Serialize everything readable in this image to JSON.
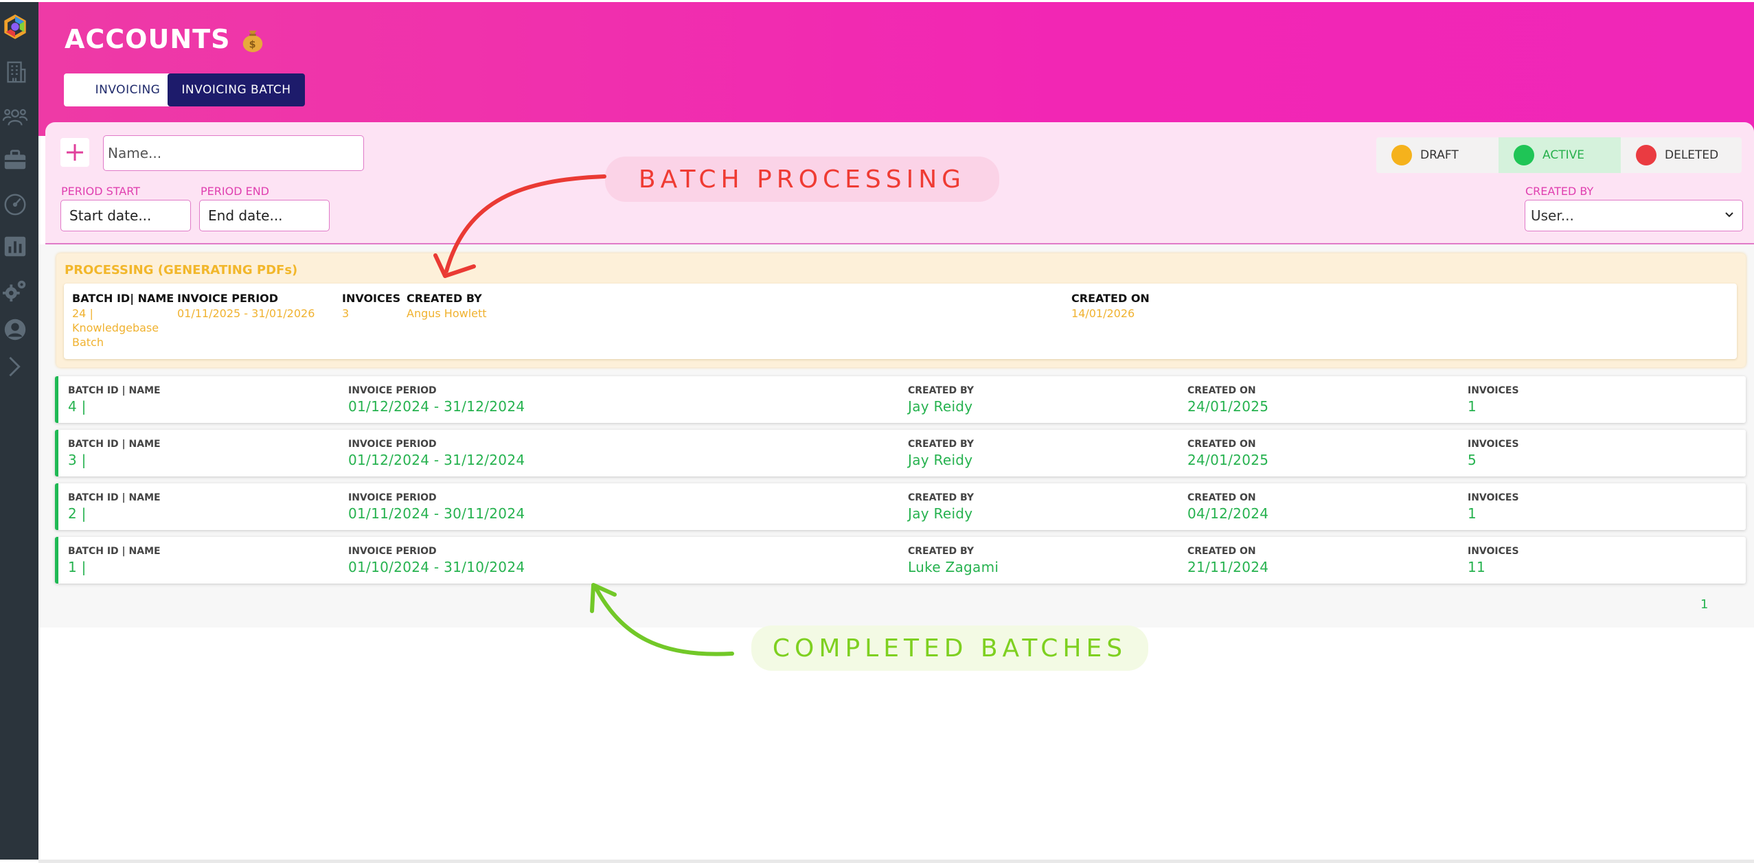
{
  "header": {
    "title": "ACCOUNTS",
    "tabs": [
      {
        "label": "INVOICING",
        "active": false
      },
      {
        "label": "INVOICING BATCH",
        "active": true
      }
    ]
  },
  "sidebar": {
    "items": [
      "logo-icon",
      "building-icon",
      "team-icon",
      "briefcase-icon",
      "speedometer-icon",
      "bar-chart-icon",
      "gears-icon",
      "support-icon",
      "expand-chevron-icon"
    ]
  },
  "filters": {
    "name_placeholder": "Name...",
    "period_start_label": "PERIOD START",
    "period_start_placeholder": "Start date...",
    "period_end_label": "PERIOD END",
    "period_end_placeholder": "End date...",
    "created_by_label": "CREATED BY",
    "created_by_value": "User...",
    "statuses": {
      "draft": "DRAFT",
      "active": "ACTIVE",
      "deleted": "DELETED"
    }
  },
  "processing": {
    "title": "PROCESSING (GENERATING PDFs)",
    "headers": {
      "batch": "BATCH ID| NAME",
      "period": "INVOICE PERIOD",
      "invoices": "INVOICES",
      "created_by": "CREATED BY",
      "created_on": "CREATED ON"
    },
    "batch_line1": "24 |",
    "batch_line2": "Knowledgebase",
    "batch_line3": "Batch",
    "period": "01/11/2025 - 31/01/2026",
    "invoices": "3",
    "created_by": "Angus Howlett",
    "created_on": "14/01/2026"
  },
  "batch_labels": {
    "batch": "BATCH ID | NAME",
    "period": "INVOICE PERIOD",
    "created_by": "CREATED BY",
    "created_on": "CREATED ON",
    "invoices": "INVOICES"
  },
  "batches": [
    {
      "id": "4 |",
      "period": "01/12/2024 - 31/12/2024",
      "created_by": "Jay Reidy",
      "created_on": "24/01/2025",
      "invoices": "1"
    },
    {
      "id": "3 |",
      "period": "01/12/2024 - 31/12/2024",
      "created_by": "Jay Reidy",
      "created_on": "24/01/2025",
      "invoices": "5"
    },
    {
      "id": "2 |",
      "period": "01/11/2024 - 30/11/2024",
      "created_by": "Jay Reidy",
      "created_on": "04/12/2024",
      "invoices": "1"
    },
    {
      "id": "1 |",
      "period": "01/10/2024 - 31/10/2024",
      "created_by": "Luke Zagami",
      "created_on": "21/11/2024",
      "invoices": "11"
    }
  ],
  "pagination": {
    "current_page": "1"
  },
  "annotations": {
    "batch_processing": "BATCH PROCESSING",
    "completed_batches": "COMPLETED BATCHES"
  },
  "colors": {
    "header_pink": "#f226b4",
    "panel_pink": "#fde3f4",
    "navy": "#1d1b6b",
    "active_green": "#26b24f",
    "processing_amber": "#f2b72b",
    "draft_dot": "#f5b21c",
    "active_dot": "#1fc556",
    "deleted_dot": "#ea3b41"
  }
}
